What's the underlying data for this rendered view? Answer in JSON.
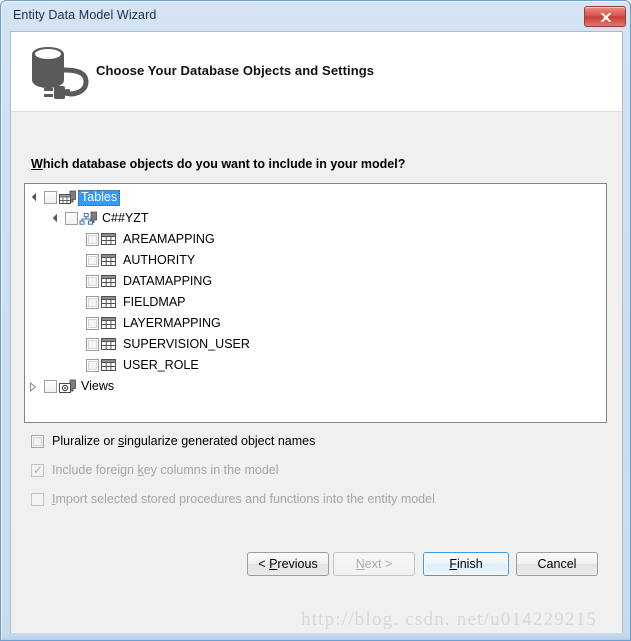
{
  "window": {
    "title": "Entity Data Model Wizard",
    "close_label": "x",
    "close_icon": "close-icon"
  },
  "header": {
    "icon": "database-connection-icon",
    "title": "Choose Your Database Objects and Settings"
  },
  "body": {
    "question_prefix": "W",
    "question_rest": "hich database objects do you want to include in your model?"
  },
  "tree": {
    "nodes": [
      {
        "label": "Tables",
        "level": 0,
        "twisty": "expanded",
        "checked": false,
        "selected": true,
        "icon": "tables-folder-icon"
      },
      {
        "label": "C##YZT",
        "level": 1,
        "twisty": "expanded",
        "checked": false,
        "selected": false,
        "icon": "schema-icon"
      },
      {
        "label": "AREAMAPPING",
        "level": 2,
        "twisty": "none",
        "checked": false,
        "selected": false,
        "icon": "table-icon"
      },
      {
        "label": "AUTHORITY",
        "level": 2,
        "twisty": "none",
        "checked": false,
        "selected": false,
        "icon": "table-icon"
      },
      {
        "label": "DATAMAPPING",
        "level": 2,
        "twisty": "none",
        "checked": false,
        "selected": false,
        "icon": "table-icon"
      },
      {
        "label": "FIELDMAP",
        "level": 2,
        "twisty": "none",
        "checked": false,
        "selected": false,
        "icon": "table-icon"
      },
      {
        "label": "LAYERMAPPING",
        "level": 2,
        "twisty": "none",
        "checked": false,
        "selected": false,
        "icon": "table-icon"
      },
      {
        "label": "SUPERVISION_USER",
        "level": 2,
        "twisty": "none",
        "checked": false,
        "selected": false,
        "icon": "table-icon"
      },
      {
        "label": "USER_ROLE",
        "level": 2,
        "twisty": "none",
        "checked": false,
        "selected": false,
        "icon": "table-icon"
      },
      {
        "label": "Views",
        "level": 0,
        "twisty": "collapsed",
        "checked": false,
        "selected": false,
        "icon": "views-folder-icon"
      }
    ]
  },
  "options": [
    {
      "pre": "Pluralize or ",
      "mnemonic": "s",
      "post": "ingularize generated object names",
      "checked": false,
      "disabled": false,
      "name": "pluralize-checkbox"
    },
    {
      "pre": "Include foreign ",
      "mnemonic": "k",
      "post": "ey columns in the model",
      "checked": true,
      "disabled": true,
      "name": "include-foreign-key-checkbox"
    },
    {
      "pre": "",
      "mnemonic": "I",
      "post": "mport selected stored procedures and functions into the entity model",
      "checked": false,
      "disabled": true,
      "name": "import-stored-procedures-checkbox"
    }
  ],
  "buttons": [
    {
      "pre": "< ",
      "mnemonic": "P",
      "post": "revious",
      "state": "normal",
      "name": "previous-button"
    },
    {
      "pre": "",
      "mnemonic": "N",
      "post": "ext >",
      "state": "disabled",
      "name": "next-button"
    },
    {
      "pre": "",
      "mnemonic": "F",
      "post": "inish",
      "state": "default",
      "name": "finish-button"
    },
    {
      "pre": "Cancel",
      "mnemonic": "",
      "post": "",
      "state": "normal",
      "name": "cancel-button"
    }
  ],
  "watermark": "http://blog. csdn. net/u014229215",
  "colors": {
    "titlebar": "#cfdff0",
    "selection": "#3399ff",
    "close_red": "#d9564c",
    "default_button_border": "#3c9ede",
    "body_bg": "#f0f0f0"
  }
}
